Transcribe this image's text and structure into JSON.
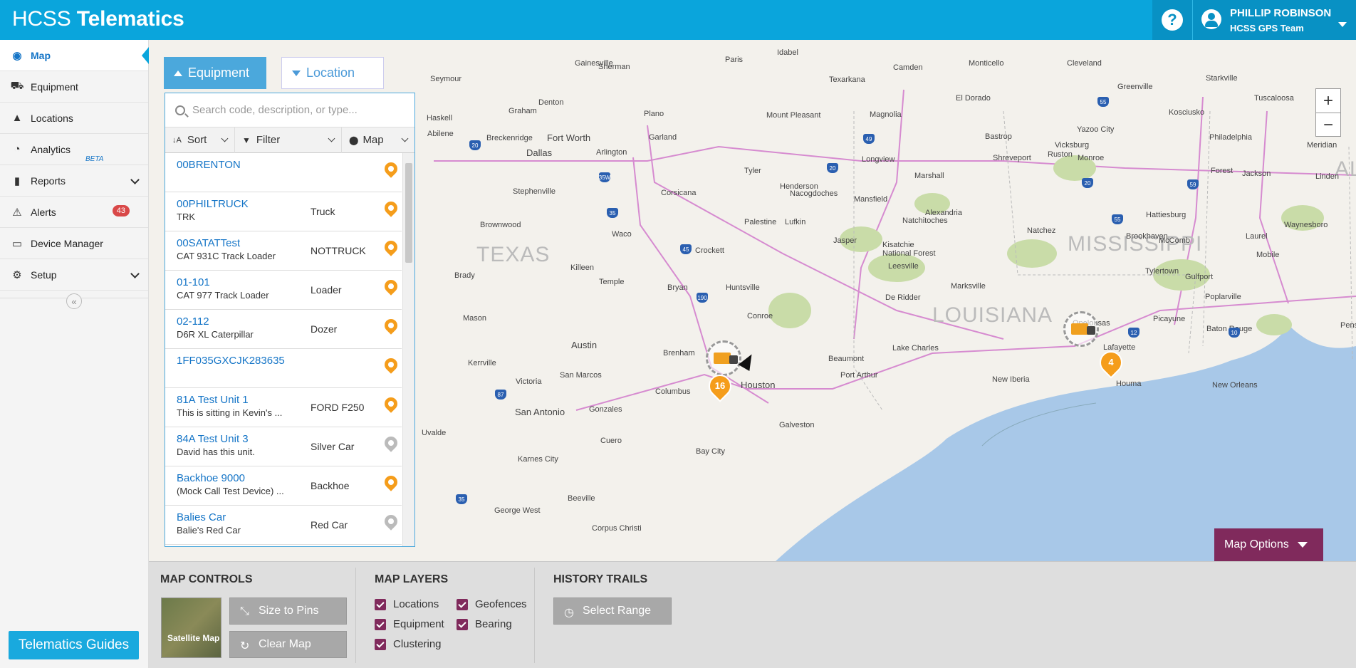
{
  "header": {
    "brand_light": "HCSS",
    "brand_bold": "Telematics",
    "help_icon": "?",
    "user_name": "PHILLIP ROBINSON",
    "user_team": "HCSS GPS Team"
  },
  "sidebar": {
    "items": [
      {
        "label": "Map",
        "icon": "globe-icon",
        "glyph": "◉"
      },
      {
        "label": "Equipment",
        "icon": "equipment-icon",
        "glyph": "⛟"
      },
      {
        "label": "Locations",
        "icon": "locations-icon",
        "glyph": "▲"
      },
      {
        "label": "Analytics",
        "icon": "pie-chart-icon",
        "glyph": "◔",
        "beta": "BETA"
      },
      {
        "label": "Reports",
        "icon": "bar-chart-icon",
        "glyph": "▮"
      },
      {
        "label": "Alerts",
        "icon": "alert-icon",
        "glyph": "⚠",
        "badge": "43"
      },
      {
        "label": "Device Manager",
        "icon": "device-icon",
        "glyph": "▭"
      },
      {
        "label": "Setup",
        "icon": "gear-icon",
        "glyph": "⚙"
      }
    ],
    "collapse_glyph": "«",
    "guides_label": "Telematics Guides"
  },
  "panel": {
    "tab_equipment": "Equipment",
    "tab_location": "Location",
    "search_placeholder": "Search code, description, or type...",
    "sort_label": "Sort",
    "filter_label": "Filter",
    "map_label": "Map",
    "rows": [
      {
        "code": "00BRENTON",
        "desc": "",
        "type": "",
        "pin": "orange"
      },
      {
        "code": "00PHILTRUCK",
        "desc": "TRK",
        "type": "Truck",
        "pin": "orange"
      },
      {
        "code": "00SATATTest",
        "desc": "CAT 931C Track Loader",
        "type": "NOTTRUCK",
        "pin": "orange"
      },
      {
        "code": "01-101",
        "desc": "CAT 977 Track Loader",
        "type": "Loader",
        "pin": "orange"
      },
      {
        "code": "02-112",
        "desc": "D6R XL Caterpillar",
        "type": "Dozer",
        "pin": "orange"
      },
      {
        "code": "1FF035GXCJK283635",
        "desc": "",
        "type": "",
        "pin": "orange"
      },
      {
        "code": "81A Test Unit 1",
        "desc": "This is sitting in Kevin's ...",
        "type": "FORD F250",
        "pin": "orange"
      },
      {
        "code": "84A Test Unit 3",
        "desc": "David has this unit.",
        "type": "Silver Car",
        "pin": "grey"
      },
      {
        "code": "Backhoe 9000",
        "desc": "(Mock Call Test Device) ...",
        "type": "Backhoe",
        "pin": "orange"
      },
      {
        "code": "Balies Car",
        "desc": "Balie's Red Car",
        "type": "Red Car",
        "pin": "grey"
      }
    ]
  },
  "map": {
    "states": [
      "TEXAS",
      "LOUISIANA",
      "MISSISSIPPI",
      "AL"
    ],
    "cities": [
      "Dallas",
      "Fort Worth",
      "Austin",
      "San Antonio",
      "Houston",
      "Shreveport",
      "Baton Rouge",
      "New Orleans",
      "Lafayette",
      "Lake Charles",
      "Beaumont",
      "Galveston",
      "Jackson",
      "Monroe",
      "Texarkana",
      "Tyler",
      "Waco",
      "Temple",
      "Killeen",
      "Huntsville",
      "Conroe",
      "Bryan",
      "Lufkin",
      "Nacogdoches",
      "Alexandria",
      "Natchez",
      "Hattiesburg",
      "Mobile",
      "Gulfport",
      "Houma",
      "Victoria",
      "Corpus Christi",
      "Vicksburg",
      "Meridian",
      "Greenville",
      "Abilene",
      "Denton",
      "Sherman",
      "Paris",
      "Plano",
      "Arlington",
      "Garland",
      "Corsicana",
      "Palestine",
      "Longview",
      "Marshall",
      "Ruston",
      "Opelousas",
      "New Iberia",
      "Port Arthur",
      "Columbus",
      "Brenham",
      "Bay City",
      "Cuero",
      "Beeville",
      "Kerrville",
      "San Marcos",
      "Gonzales",
      "Karnes City",
      "George West",
      "Uvalde",
      "Brady",
      "Mason",
      "Brownwood",
      "Stephenville",
      "Breckenridge",
      "Graham",
      "Haskell",
      "Seymour",
      "Gainesville",
      "Camden",
      "El Dorado",
      "Magnolia",
      "Mansfield",
      "Natchitoches",
      "Jasper",
      "Crockett",
      "Henderson",
      "Mount Pleasant",
      "Monticello",
      "Cleveland",
      "Starkville",
      "Tuscaloosa",
      "Kosciusko",
      "Philadelphia",
      "Forest",
      "Brookhaven",
      "McComb",
      "Tylertown",
      "Poplarville",
      "Picayune",
      "Pensacola",
      "Laurel",
      "Waynesboro",
      "Linden",
      "Yazoo City",
      "Bastrop",
      "Leesville",
      "De Ridder",
      "Marksville",
      "Idabel",
      "Kisatchie National Forest"
    ],
    "cluster_counts": [
      "16",
      "4"
    ],
    "zoom_in": "+",
    "zoom_out": "−",
    "map_options": "Map Options"
  },
  "controls": {
    "map_controls_title": "MAP CONTROLS",
    "satellite_label": "Satellite Map",
    "size_to_pins": "Size to Pins",
    "clear_map": "Clear Map",
    "map_layers_title": "MAP LAYERS",
    "layers": [
      "Locations",
      "Equipment",
      "Clustering",
      "Geofences",
      "Bearing"
    ],
    "history_title": "HISTORY TRAILS",
    "select_range": "Select Range"
  },
  "colors": {
    "header": "#0aa5dc",
    "accent_maroon": "#802a5c",
    "link": "#1575c7",
    "pin": "#f59d1b"
  }
}
